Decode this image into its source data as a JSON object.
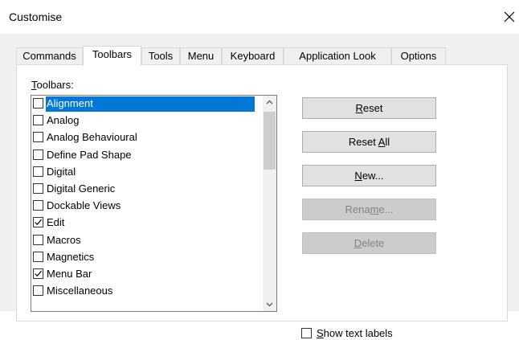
{
  "window": {
    "title": "Customise"
  },
  "tabs": [
    {
      "label": "Commands",
      "active": false
    },
    {
      "label": "Toolbars",
      "active": true
    },
    {
      "label": "Tools",
      "active": false
    },
    {
      "label": "Menu",
      "active": false
    },
    {
      "label": "Keyboard",
      "active": false
    },
    {
      "label": "Application Look",
      "active": false
    },
    {
      "label": "Options",
      "active": false
    }
  ],
  "toolbars_label": {
    "hotkey": "T",
    "rest": "oolbars:"
  },
  "toolbars": [
    {
      "label": "Alignment",
      "checked": false,
      "selected": true
    },
    {
      "label": "Analog",
      "checked": false,
      "selected": false
    },
    {
      "label": "Analog Behavioural",
      "checked": false,
      "selected": false
    },
    {
      "label": "Define Pad Shape",
      "checked": false,
      "selected": false
    },
    {
      "label": "Digital",
      "checked": false,
      "selected": false
    },
    {
      "label": "Digital Generic",
      "checked": false,
      "selected": false
    },
    {
      "label": "Dockable Views",
      "checked": false,
      "selected": false
    },
    {
      "label": "Edit",
      "checked": true,
      "selected": false
    },
    {
      "label": "Macros",
      "checked": false,
      "selected": false
    },
    {
      "label": "Magnetics",
      "checked": false,
      "selected": false
    },
    {
      "label": "Menu Bar",
      "checked": true,
      "selected": false
    },
    {
      "label": "Miscellaneous",
      "checked": false,
      "selected": false
    }
  ],
  "buttons": {
    "reset": {
      "pre": "",
      "u": "R",
      "post": "eset"
    },
    "reset_all": {
      "pre": "Reset ",
      "u": "A",
      "post": "ll"
    },
    "new": {
      "pre": "",
      "u": "N",
      "post": "ew..."
    },
    "rename": {
      "pre": "Rena",
      "u": "m",
      "post": "e..."
    },
    "delete": {
      "pre": "",
      "u": "D",
      "post": "elete"
    }
  },
  "show_text_labels": {
    "hotkey": "S",
    "rest": "how text labels",
    "checked": false
  },
  "icons": {
    "close": "close-icon",
    "scroll_up": "scroll-up-arrow-icon",
    "scroll_down": "scroll-down-arrow-icon",
    "checkmark": "checkmark-icon"
  },
  "colors": {
    "selection": "#0078d7",
    "dialog_bg": "#f0f0f0"
  }
}
